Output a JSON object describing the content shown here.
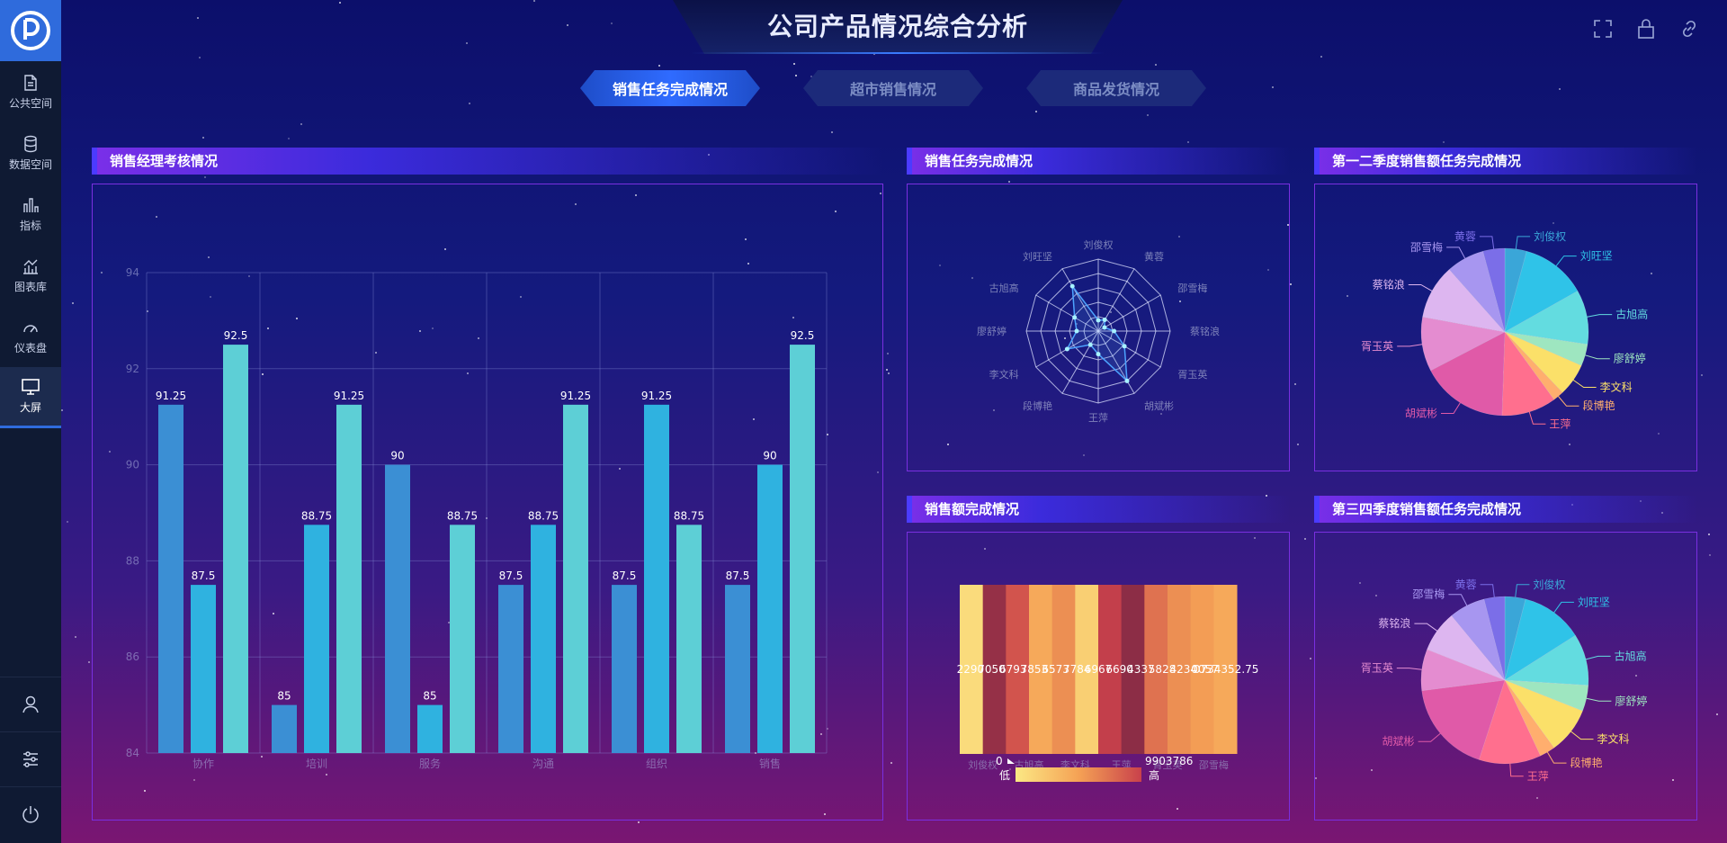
{
  "sidebar": {
    "items": [
      {
        "label": "公共空间",
        "icon": "document-icon"
      },
      {
        "label": "数据空间",
        "icon": "database-icon"
      },
      {
        "label": "指标",
        "icon": "bar-chart-icon"
      },
      {
        "label": "图表库",
        "icon": "chart-library-icon"
      },
      {
        "label": "仪表盘",
        "icon": "gauge-icon"
      },
      {
        "label": "大屏",
        "icon": "monitor-icon"
      }
    ],
    "active_index": 5
  },
  "header": {
    "title": "公司产品情况综合分析",
    "tabs": [
      {
        "label": "销售任务完成情况",
        "active": true
      },
      {
        "label": "超市销售情况",
        "active": false
      },
      {
        "label": "商品发货情况",
        "active": false
      }
    ]
  },
  "panels": {
    "bar": {
      "title": "销售经理考核情况"
    },
    "radar": {
      "title": "销售任务完成情况"
    },
    "pie1": {
      "title": "第一二季度销售额任务完成情况"
    },
    "heatmap": {
      "title": "销售额完成情况"
    },
    "pie2": {
      "title": "第三四季度销售额任务完成情况"
    }
  },
  "heatmap_labels": {
    "low_value": "0",
    "high_value": "9903786",
    "low": "低",
    "high": "高"
  },
  "colors": {
    "accent": "#2f6bdc",
    "panel_border": "#7a2fe0",
    "bar_series": [
      "#3b8fd4",
      "#2fb2e0",
      "#5dcfd6"
    ]
  },
  "chart_data": [
    {
      "type": "bar",
      "title": "销售经理考核情况",
      "categories": [
        "协作",
        "培训",
        "服务",
        "沟通",
        "组织",
        "销售"
      ],
      "series": [
        {
          "values": [
            91.25,
            85,
            90,
            87.5,
            87.5,
            87.5
          ]
        },
        {
          "values": [
            87.5,
            88.75,
            85,
            88.75,
            91.25,
            90
          ]
        },
        {
          "values": [
            92.5,
            91.25,
            88.75,
            91.25,
            88.75,
            92.5
          ]
        }
      ],
      "ylim": [
        84,
        94
      ],
      "yticks": [
        84,
        86,
        88,
        90,
        92,
        94
      ],
      "grid": true
    },
    {
      "type": "radar",
      "title": "销售任务完成情况",
      "indicators": [
        "刘俊权",
        "黄蓉",
        "邵雪梅",
        "蔡铭浪",
        "胥玉英",
        "胡斌彬",
        "王萍",
        "段博艳",
        "李文科",
        "廖舒婷",
        "古旭高",
        "刘旺坚"
      ],
      "values": [
        0.15,
        0.18,
        0.1,
        0.22,
        0.42,
        0.8,
        0.32,
        0.22,
        0.5,
        0.3,
        0.38,
        0.72
      ]
    },
    {
      "type": "pie",
      "title": "第一二季度销售额任务完成情况",
      "slices": [
        {
          "name": "刘俊权",
          "value": 4,
          "color": "#3aa6d8"
        },
        {
          "name": "刘旺坚",
          "value": 12,
          "color": "#2fc3e8"
        },
        {
          "name": "古旭高",
          "value": 10,
          "color": "#63dce0"
        },
        {
          "name": "廖舒婷",
          "value": 4,
          "color": "#9ee6c0"
        },
        {
          "name": "李文科",
          "value": 6,
          "color": "#fbe069"
        },
        {
          "name": "段博艳",
          "value": 2,
          "color": "#ffae6e"
        },
        {
          "name": "王萍",
          "value": 10,
          "color": "#ff6f8e"
        },
        {
          "name": "胡斌彬",
          "value": 16,
          "color": "#e05aa8"
        },
        {
          "name": "胥玉英",
          "value": 10,
          "color": "#e48cd0"
        },
        {
          "name": "蔡铭浪",
          "value": 10,
          "color": "#ddb6f0"
        },
        {
          "name": "邵雪梅",
          "value": 7,
          "color": "#a796f0"
        },
        {
          "name": "黄蓉",
          "value": 4,
          "color": "#7b6ee8"
        }
      ]
    },
    {
      "type": "heatmap",
      "title": "销售额完成情况",
      "x": [
        "刘俊权",
        "古旭高",
        "李文科",
        "王萍",
        "胥玉英",
        "邵雪梅"
      ],
      "cells": [
        6,
        95,
        60,
        30,
        40,
        12,
        70,
        100,
        50,
        40,
        35,
        30
      ],
      "value_labels": [
        "2290",
        "7050",
        "6793",
        "7853",
        "6573",
        "7784",
        "6967",
        "6690",
        "4337",
        "5828",
        "4234",
        "0057",
        "0734352.75"
      ],
      "visual_map": {
        "min": 0,
        "max": 9903786,
        "low_label": "低",
        "high_label": "高"
      }
    },
    {
      "type": "pie",
      "title": "第三四季度销售额任务完成情况",
      "slices": [
        {
          "name": "刘俊权",
          "value": 4,
          "color": "#3aa6d8"
        },
        {
          "name": "刘旺坚",
          "value": 12,
          "color": "#2fc3e8"
        },
        {
          "name": "古旭高",
          "value": 10,
          "color": "#63dce0"
        },
        {
          "name": "廖舒婷",
          "value": 5,
          "color": "#9ee6c0"
        },
        {
          "name": "李文科",
          "value": 9,
          "color": "#fbe069"
        },
        {
          "name": "段博艳",
          "value": 3,
          "color": "#ffae6e"
        },
        {
          "name": "王萍",
          "value": 12,
          "color": "#ff6f8e"
        },
        {
          "name": "胡斌彬",
          "value": 18,
          "color": "#e05aa8"
        },
        {
          "name": "胥玉英",
          "value": 8,
          "color": "#e48cd0"
        },
        {
          "name": "蔡铭浪",
          "value": 8,
          "color": "#ddb6f0"
        },
        {
          "name": "邵雪梅",
          "value": 7,
          "color": "#a796f0"
        },
        {
          "name": "黄蓉",
          "value": 4,
          "color": "#7b6ee8"
        }
      ]
    }
  ]
}
